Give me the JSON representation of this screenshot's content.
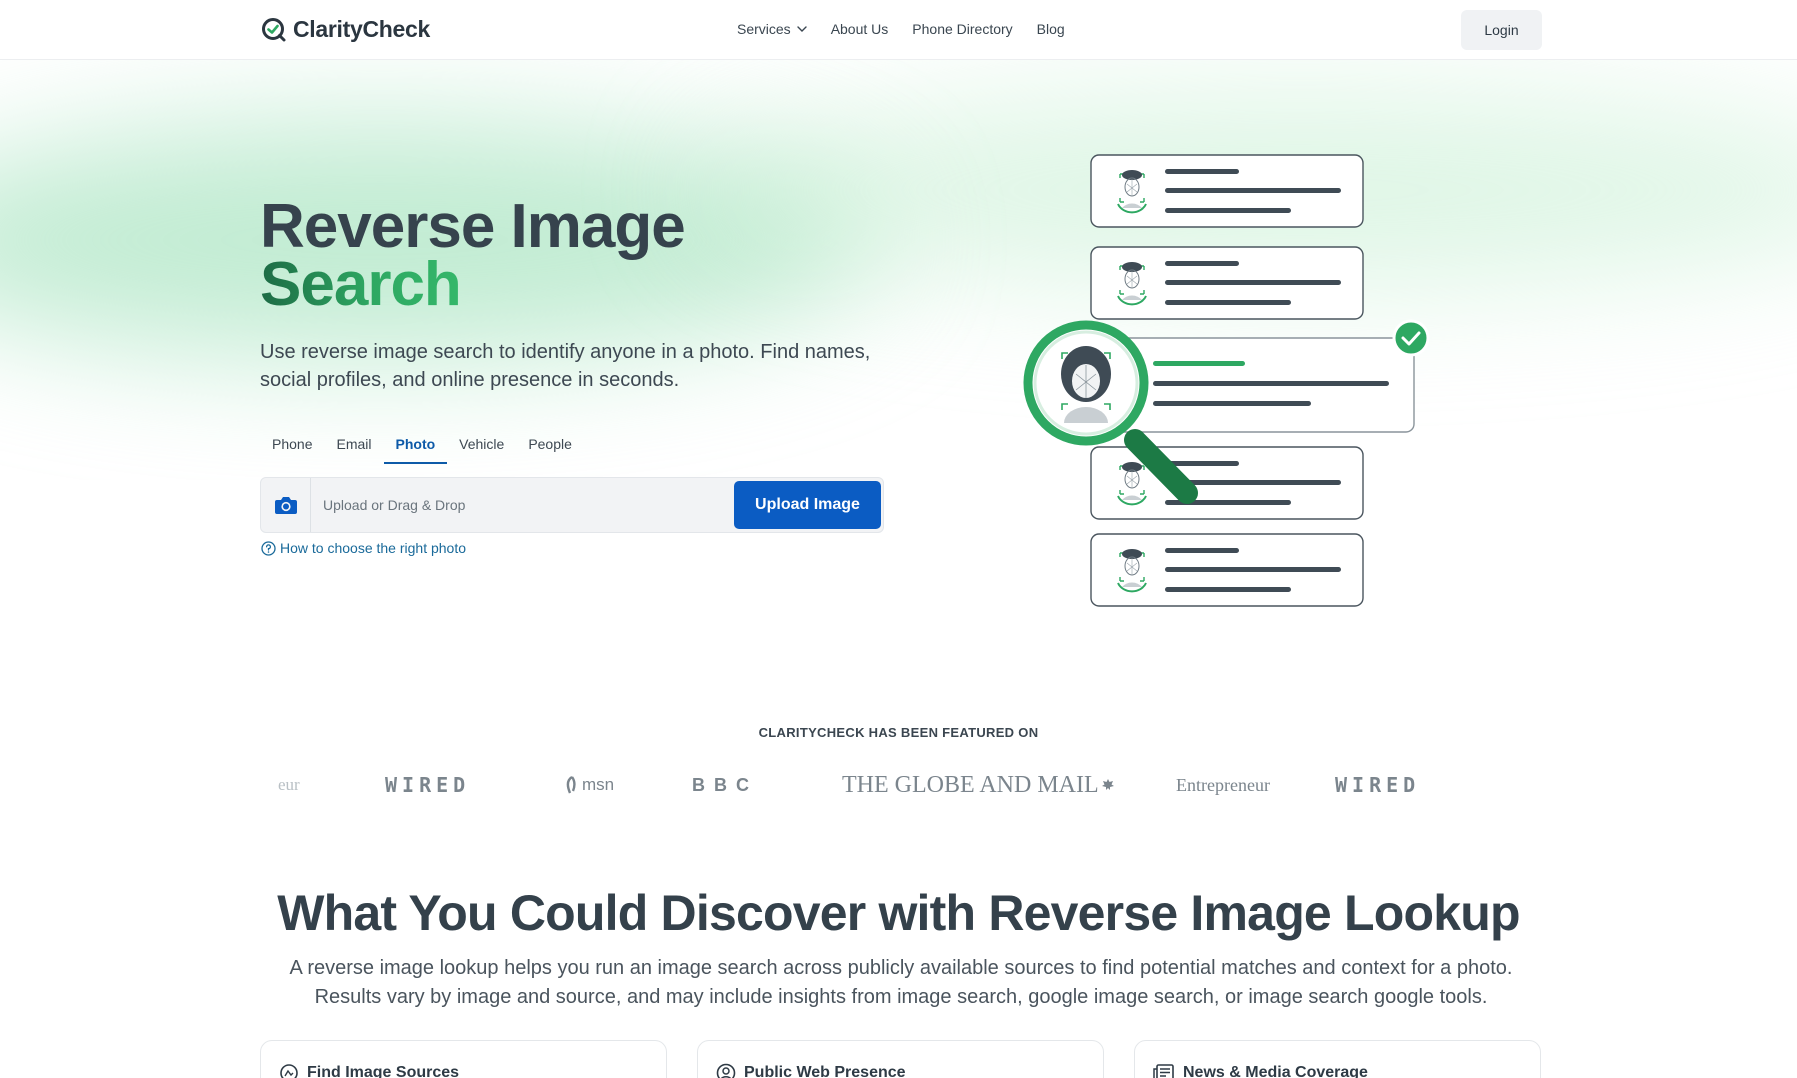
{
  "brand": {
    "name": "ClarityCheck",
    "accent": "#2ea862",
    "primary": "#0b5cc3"
  },
  "nav": {
    "items": [
      {
        "label": "Services",
        "has_dropdown": true
      },
      {
        "label": "About Us"
      },
      {
        "label": "Phone Directory"
      },
      {
        "label": "Blog"
      }
    ],
    "login_label": "Login"
  },
  "hero": {
    "title_line1": "Reverse Image",
    "title_line2": "Search",
    "subtitle": "Use reverse image search to identify anyone in a photo. Find names, social profiles, and online presence in seconds.",
    "tabs": [
      {
        "label": "Phone",
        "active": false
      },
      {
        "label": "Email",
        "active": false
      },
      {
        "label": "Photo",
        "active": true
      },
      {
        "label": "Vehicle",
        "active": false
      },
      {
        "label": "People",
        "active": false
      }
    ],
    "search": {
      "placeholder": "Upload or Drag & Drop",
      "value": "",
      "button_label": "Upload Image",
      "icon": "camera-icon"
    },
    "help_link": "How to choose the right photo"
  },
  "featured": {
    "label": "CLARITYCHECK HAS BEEN FEATURED ON",
    "logos": [
      "eur",
      "WIRED",
      "msn",
      "BBC",
      "THE GLOBE AND MAIL",
      "Entrepreneur",
      "WIRED"
    ]
  },
  "discover": {
    "title": "What You Could Discover with Reverse Image Lookup",
    "subtitle": "A reverse image lookup helps you run an image search across publicly available sources to find potential matches and context for a photo. Results vary by image and source, and may include insights from image search, google image search, or image search google tools.",
    "cards": [
      {
        "title": "Find Image Sources",
        "icon": "image-source-icon"
      },
      {
        "title": "Public Web Presence",
        "icon": "user-circle-icon"
      },
      {
        "title": "News & Media Coverage",
        "icon": "newspaper-icon"
      }
    ]
  }
}
